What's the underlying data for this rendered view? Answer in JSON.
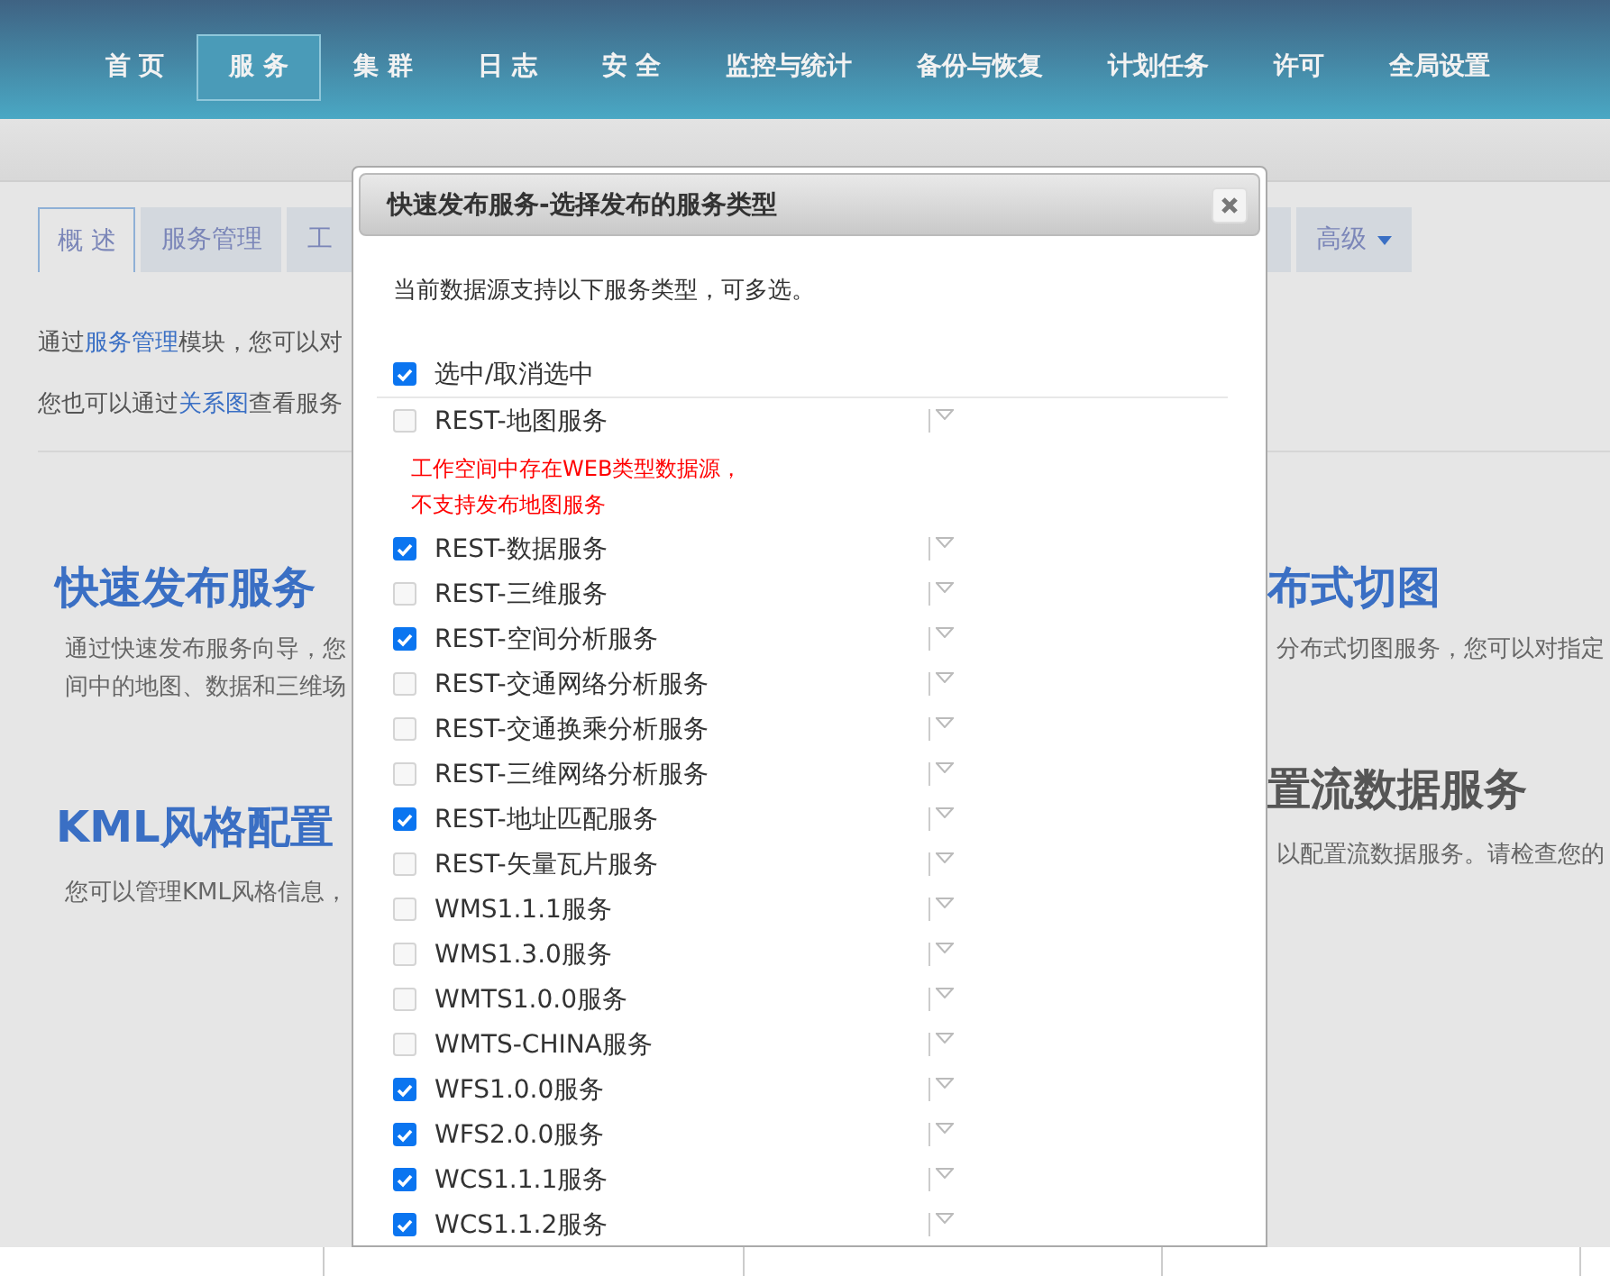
{
  "nav": [
    {
      "label": "首 页",
      "selected": false
    },
    {
      "label": "服 务",
      "selected": true
    },
    {
      "label": "集 群",
      "selected": false
    },
    {
      "label": "日 志",
      "selected": false
    },
    {
      "label": "安 全",
      "selected": false
    },
    {
      "label": "监控与统计",
      "selected": false
    },
    {
      "label": "备份与恢复",
      "selected": false
    },
    {
      "label": "计划任务",
      "selected": false
    },
    {
      "label": "许可",
      "selected": false
    },
    {
      "label": "全局设置",
      "selected": false
    }
  ],
  "left": {
    "tabs": [
      {
        "label": "概 述",
        "selected": true
      },
      {
        "label": "服务管理",
        "selected": false
      },
      {
        "label": "工",
        "selected": false
      }
    ],
    "paragraphs": [
      {
        "before": "通过",
        "link": "服务管理",
        "after": "模块，您可以对"
      },
      {
        "before": "您也可以通过",
        "link": "关系图",
        "after": "查看服务"
      }
    ],
    "sections": [
      {
        "heading": "快速发布服务",
        "kind": "link",
        "lines": [
          "通过快速发布服务向导，您",
          "间中的地图、数据和三维场"
        ]
      },
      {
        "heading": "KML风格配置",
        "kind": "link",
        "lines": [
          "您可以管理KML风格信息，"
        ]
      }
    ]
  },
  "right": {
    "tabs": [
      {
        "label": "高级",
        "selected": false
      }
    ],
    "sections": [
      {
        "heading": "布式切图",
        "kind": "link",
        "lines": [
          "分布式切图服务，您可以对指定"
        ]
      },
      {
        "heading": "置流数据服务",
        "kind": "plain",
        "lines": [
          "以配置流数据服务。请检查您的"
        ]
      }
    ]
  },
  "dialog": {
    "title": "快速发布服务-选择发布的服务类型",
    "intro": "当前数据源支持以下服务类型，可多选。",
    "select_all": {
      "label": "选中/取消选中",
      "checked": true
    },
    "services": [
      {
        "label": "REST-地图服务",
        "checked": false,
        "warning": [
          "工作空间中存在WEB类型数据源，",
          "不支持发布地图服务"
        ]
      },
      {
        "label": "REST-数据服务",
        "checked": true
      },
      {
        "label": "REST-三维服务",
        "checked": false
      },
      {
        "label": "REST-空间分析服务",
        "checked": true
      },
      {
        "label": "REST-交通网络分析服务",
        "checked": false
      },
      {
        "label": "REST-交通换乘分析服务",
        "checked": false
      },
      {
        "label": "REST-三维网络分析服务",
        "checked": false
      },
      {
        "label": "REST-地址匹配服务",
        "checked": true
      },
      {
        "label": "REST-矢量瓦片服务",
        "checked": false
      },
      {
        "label": "WMS1.1.1服务",
        "checked": false
      },
      {
        "label": "WMS1.3.0服务",
        "checked": false
      },
      {
        "label": "WMTS1.0.0服务",
        "checked": false
      },
      {
        "label": "WMTS-CHINA服务",
        "checked": false
      },
      {
        "label": "WFS1.0.0服务",
        "checked": true
      },
      {
        "label": "WFS2.0.0服务",
        "checked": true
      },
      {
        "label": "WCS1.1.1服务",
        "checked": true
      },
      {
        "label": "WCS1.1.2服务",
        "checked": true
      }
    ]
  }
}
